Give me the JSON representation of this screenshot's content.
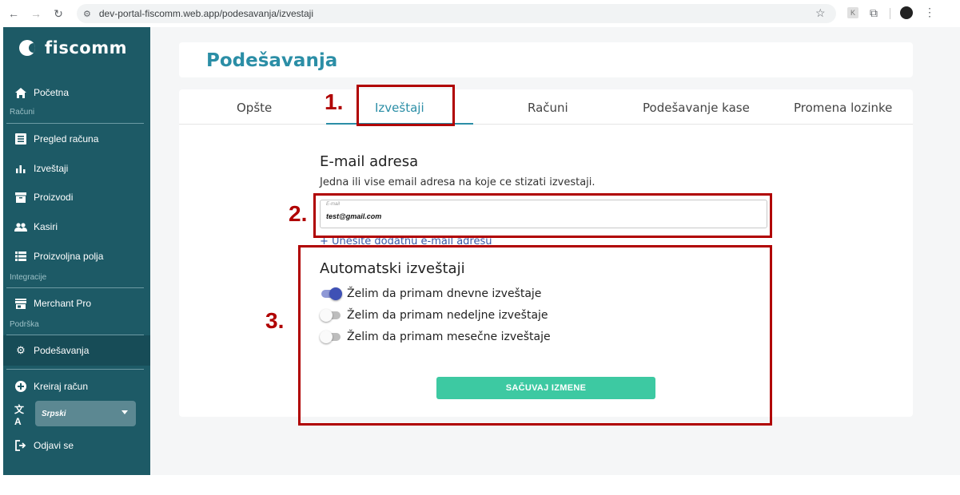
{
  "browser": {
    "url": "dev-portal-fiscomm.web.app/podesavanja/izvestaji"
  },
  "sidebar": {
    "logo_text": "fiscomm",
    "home": "Početna",
    "section_racuni": "Računi",
    "items_racuni": [
      "Pregled računa",
      "Izveštaji",
      "Proizvodi",
      "Kasiri",
      "Proizvoljna polja"
    ],
    "section_integracije": "Integracije",
    "merchant": "Merchant Pro",
    "section_podrska": "Podrška",
    "settings": "Podešavanja",
    "create_receipt": "Kreiraj račun",
    "language": "Srpski",
    "logout": "Odjavi se"
  },
  "page": {
    "title": "Podešavanja"
  },
  "tabs": [
    "Opšte",
    "Izveštaji",
    "Računi",
    "Podešavanje kase",
    "Promena lozinke"
  ],
  "email_section": {
    "title": "E-mail adresa",
    "description": "Jedna ili vise email adresa na koje ce stizati izvestaji.",
    "field_label": "E-mail",
    "field_value": "test@gmail.com",
    "add_link": "+ Unesite dodatnu e-mail adresu"
  },
  "auto_reports": {
    "title": "Automatski izveštaji",
    "daily": "Želim da primam dnevne izveštaje",
    "weekly": "Želim da primam nedeljne izveštaje",
    "monthly": "Želim da primam mesečne izveštaje",
    "daily_on": true,
    "weekly_on": false,
    "monthly_on": false
  },
  "save_button": "SAČUVAJ IZMENE",
  "annotations": [
    "1.",
    "2.",
    "3."
  ],
  "colors": {
    "sidebar": "#1d5a66",
    "accent": "#2b8ea6",
    "save": "#3dc9a2",
    "annotation": "#b00000",
    "toggle_on": "#3f51b5"
  }
}
